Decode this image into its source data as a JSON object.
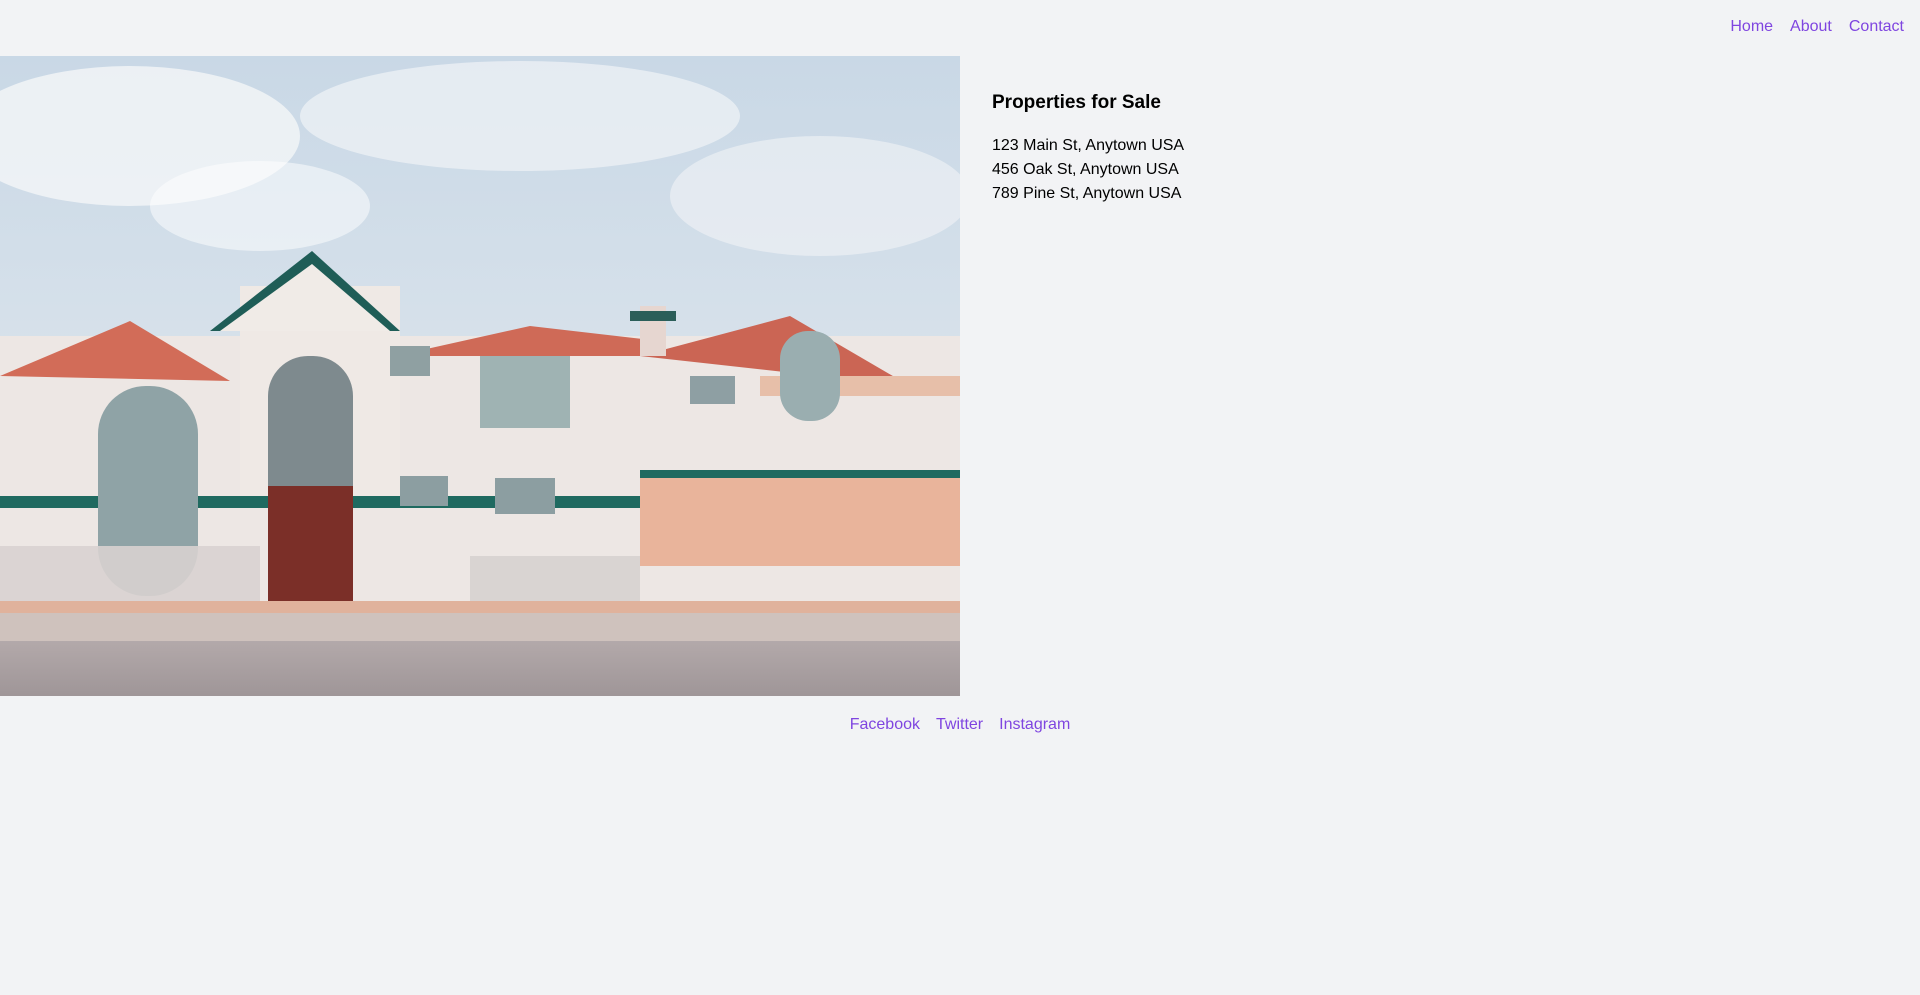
{
  "nav": {
    "items": [
      {
        "label": "Home"
      },
      {
        "label": "About"
      },
      {
        "label": "Contact"
      }
    ]
  },
  "hero": {
    "image_subject": "house-photo"
  },
  "listing": {
    "title": "Properties for Sale",
    "properties": [
      {
        "address": "123 Main St, Anytown USA"
      },
      {
        "address": "456 Oak St, Anytown USA"
      },
      {
        "address": "789 Pine St, Anytown USA"
      }
    ]
  },
  "footer": {
    "links": [
      {
        "label": "Facebook"
      },
      {
        "label": "Twitter"
      },
      {
        "label": "Instagram"
      }
    ]
  },
  "colors": {
    "background": "#f2f3f5",
    "link": "#7f45e0",
    "text": "#000000"
  }
}
